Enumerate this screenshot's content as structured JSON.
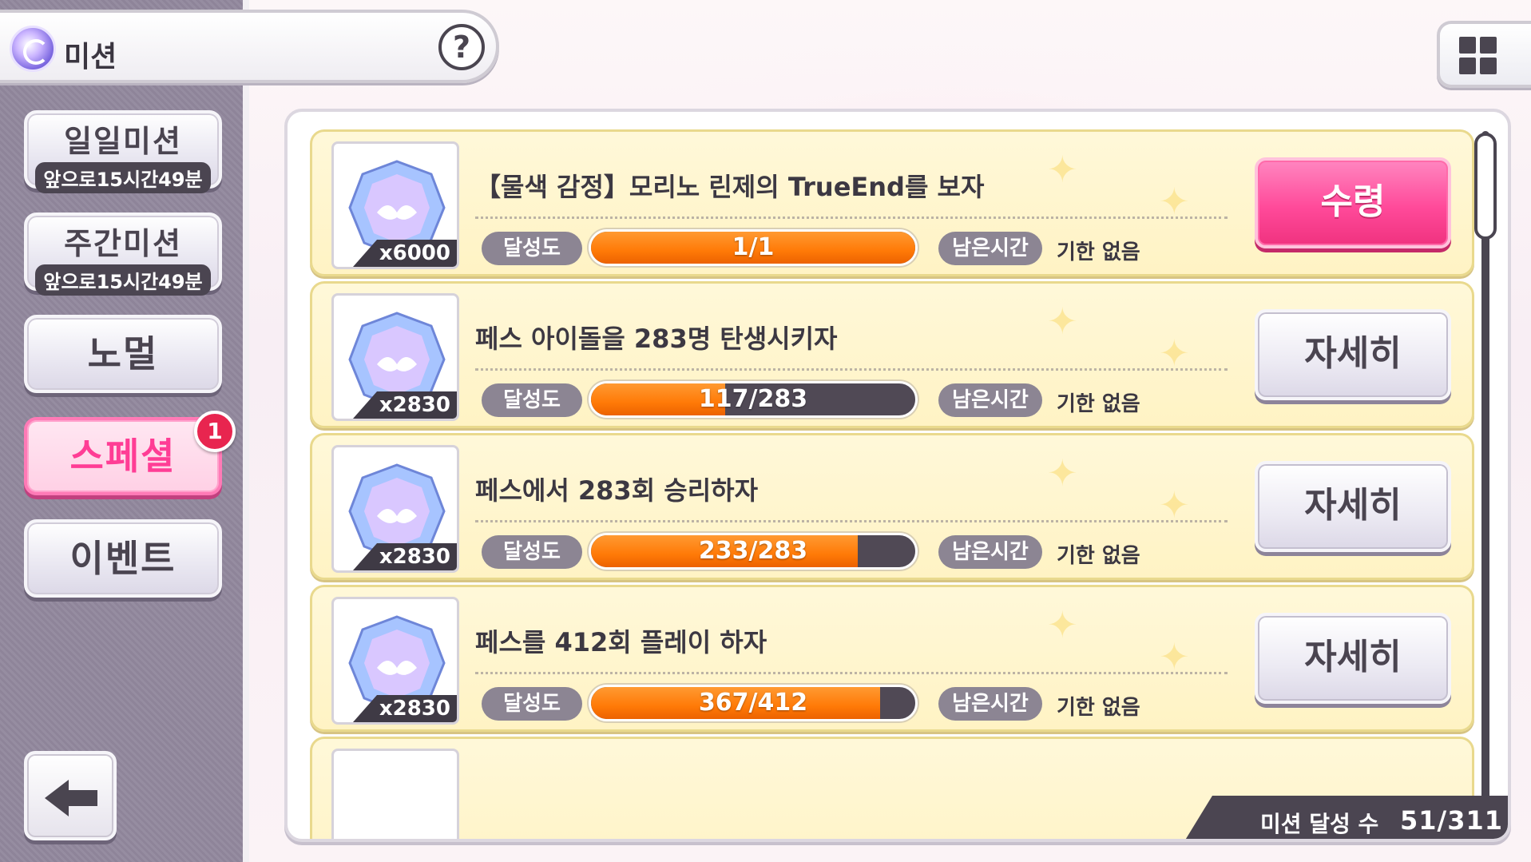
{
  "header": {
    "title": "미션",
    "help_label": "?"
  },
  "sidebar": {
    "items": [
      {
        "label": "일일미션",
        "sub": "앞으로15시간49분"
      },
      {
        "label": "주간미션",
        "sub": "앞으로15시간49분"
      },
      {
        "label": "노멀"
      },
      {
        "label": "스페셜",
        "badge": "1"
      },
      {
        "label": "이벤트"
      }
    ]
  },
  "missions": [
    {
      "reward_qty": "x6000",
      "title": "【물색 감정】모리노 린제의 TrueEnd를 보자",
      "achv_label": "달성도",
      "progress_text": "1/1",
      "progress": 1.0,
      "time_label": "남은시간",
      "time_value": "기한 없음",
      "action": "수령"
    },
    {
      "reward_qty": "x2830",
      "title": "페스 아이돌을 283명 탄생시키자",
      "achv_label": "달성도",
      "progress_text": "117/283",
      "progress": 0.413,
      "time_label": "남은시간",
      "time_value": "기한 없음",
      "action": "자세히"
    },
    {
      "reward_qty": "x2830",
      "title": "페스에서 283회 승리하자",
      "achv_label": "달성도",
      "progress_text": "233/283",
      "progress": 0.823,
      "time_label": "남은시간",
      "time_value": "기한 없음",
      "action": "자세히"
    },
    {
      "reward_qty": "x2830",
      "title": "페스를 412회 플레이 하자",
      "achv_label": "달성도",
      "progress_text": "367/412",
      "progress": 0.891,
      "time_label": "남은시간",
      "time_value": "기한 없음",
      "action": "자세히"
    }
  ],
  "footer": {
    "label": "미션 달성 수",
    "value": "51/311"
  },
  "colors": {
    "accent_pink": "#ff4a9a",
    "progress_orange": "#ff7a07",
    "badge_red": "#e8254f"
  },
  "icons": [
    "mission-icon",
    "help-icon",
    "grid-menu-icon",
    "back-arrow-icon",
    "gem-icon"
  ]
}
